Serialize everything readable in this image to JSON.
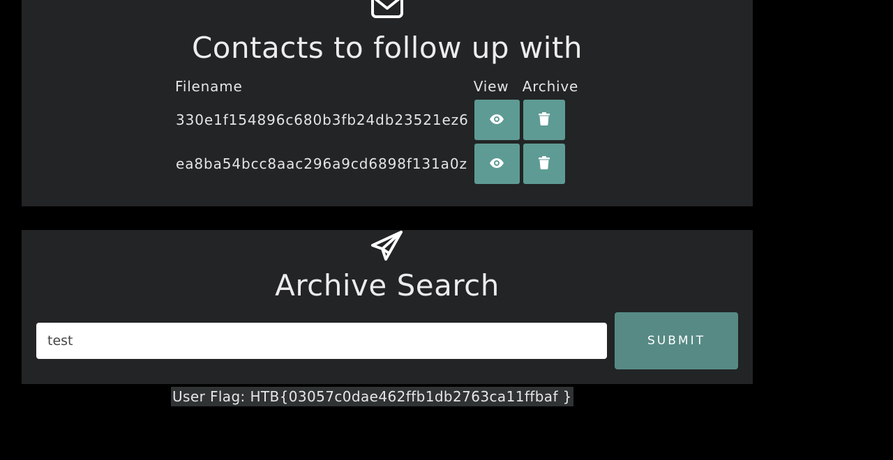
{
  "contacts_card": {
    "icon": "envelope-icon",
    "title": "Contacts to follow up with",
    "columns": {
      "filename": "Filename",
      "view": "View",
      "archive": "Archive"
    },
    "rows": [
      {
        "filename": "330e1f154896c680b3fb24db23521ez6",
        "view_icon": "eye-icon",
        "archive_icon": "trash-icon"
      },
      {
        "filename": "ea8ba54bcc8aac296a9cd6898f131a0z",
        "view_icon": "eye-icon",
        "archive_icon": "trash-icon"
      }
    ]
  },
  "search_card": {
    "icon": "paper-plane-icon",
    "title": "Archive Search",
    "input_value": "test",
    "submit_label": "SUBMIT"
  },
  "flag": {
    "text": "User Flag: HTB{03057c0dae462ffb1db2763ca11ffbaf }"
  },
  "colors": {
    "page_background": "#000000",
    "card_background": "#222425",
    "action_button": "#5e9b94",
    "submit_button": "#578a84",
    "flag_highlight": "#303334"
  }
}
